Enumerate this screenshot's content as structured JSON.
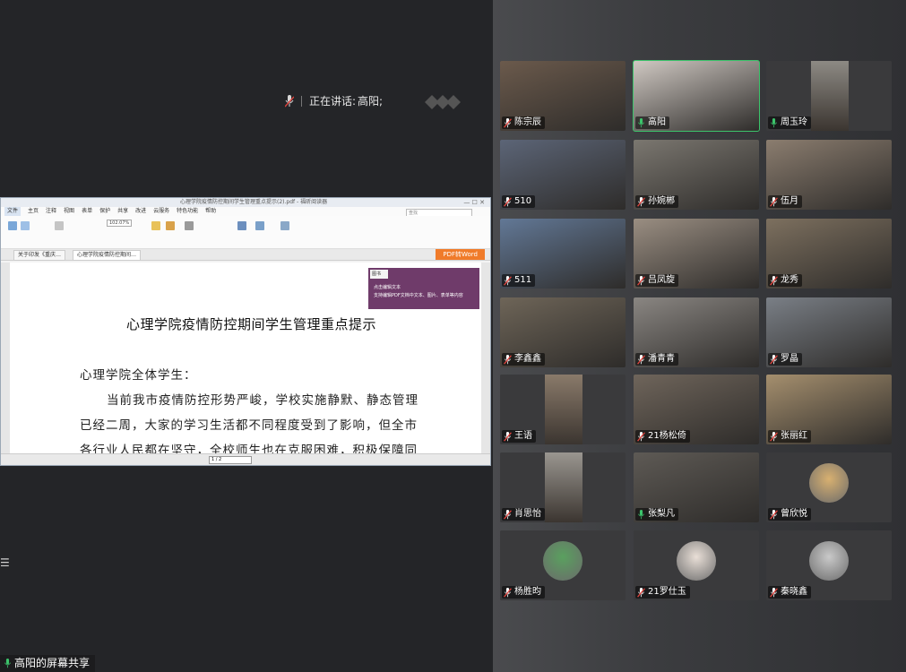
{
  "speaking": {
    "prefix": "正在讲话:",
    "name": "高阳;"
  },
  "share_label": "高阳的屏幕共享",
  "document": {
    "window_title": "心理学院疫情防控期间学生管理重点提示(2).pdf - 福昕阅读器",
    "search_placeholder": "查找",
    "menu": [
      "文件",
      "主页",
      "注释",
      "视图",
      "表单",
      "保护",
      "共享",
      "改进",
      "云服务",
      "特色功能",
      "帮助"
    ],
    "zoom": "102.07%",
    "tabs": [
      "关于印发《重庆…",
      "心理学院疫情防控期间…"
    ],
    "pdf_to_word": "PDF转Word",
    "popup_title": "图书",
    "popup_lines": [
      "点击编辑文本",
      "支持编辑PDF文档中文本、图片、表单等内容"
    ],
    "heading": "心理学院疫情防控期间学生管理重点提示",
    "paragraphs": [
      "心理学院全体学生：",
      "当前我市疫情防控形势严峻，学校实施静默、静态管理",
      "已经二周，大家的学习生活都不同程度受到了影响，但全市",
      "各行业人民都在坚守，全校师生也在克服困难，积极保障同"
    ],
    "page_indicator": "1 / 2"
  },
  "participants": [
    {
      "name": "陈宗辰",
      "muted": true,
      "active": false,
      "kind": "video",
      "scene": "#6b5a4c"
    },
    {
      "name": "高阳",
      "muted": false,
      "active": true,
      "kind": "video",
      "scene": "#cfc8c2"
    },
    {
      "name": "周玉玲",
      "muted": false,
      "active": false,
      "kind": "video-narrow",
      "scene": "#8d8a84"
    },
    {
      "name": "510",
      "muted": true,
      "active": false,
      "kind": "video",
      "scene": "#5c6577"
    },
    {
      "name": "孙婉郴",
      "muted": true,
      "active": false,
      "kind": "video",
      "scene": "#7b7770"
    },
    {
      "name": "伍月",
      "muted": true,
      "active": false,
      "kind": "video",
      "scene": "#8b7d6f"
    },
    {
      "name": "511",
      "muted": true,
      "active": false,
      "kind": "video",
      "scene": "#627896"
    },
    {
      "name": "吕凤旋",
      "muted": true,
      "active": false,
      "kind": "video",
      "scene": "#9a8e82"
    },
    {
      "name": "龙秀",
      "muted": true,
      "active": false,
      "kind": "video",
      "scene": "#7d705f"
    },
    {
      "name": "李鑫鑫",
      "muted": true,
      "active": false,
      "kind": "video",
      "scene": "#6e6558"
    },
    {
      "name": "潘青青",
      "muted": true,
      "active": false,
      "kind": "video",
      "scene": "#8a8682"
    },
    {
      "name": "罗晶",
      "muted": true,
      "active": false,
      "kind": "video",
      "scene": "#7a7f86"
    },
    {
      "name": "王语",
      "muted": true,
      "active": false,
      "kind": "video-narrow",
      "scene": "#8a7a6a"
    },
    {
      "name": "21杨松倚",
      "muted": true,
      "active": false,
      "kind": "video",
      "scene": "#6f655b"
    },
    {
      "name": "张丽红",
      "muted": true,
      "active": false,
      "kind": "video",
      "scene": "#a58f6e"
    },
    {
      "name": "肖思怡",
      "muted": true,
      "active": false,
      "kind": "video-narrow",
      "scene": "#9a9690"
    },
    {
      "name": "张梨凡",
      "muted": false,
      "active": false,
      "kind": "video",
      "scene": "#5e5a55"
    },
    {
      "name": "曾欣悦",
      "muted": true,
      "active": false,
      "kind": "avatar",
      "scene": "#d8b070"
    },
    {
      "name": "杨胜昀",
      "muted": true,
      "active": false,
      "kind": "avatar",
      "scene": "#5aa05f"
    },
    {
      "name": "21罗仕玉",
      "muted": true,
      "active": false,
      "kind": "avatar",
      "scene": "#e9dfd7"
    },
    {
      "name": "秦晓鑫",
      "muted": true,
      "active": false,
      "kind": "avatar",
      "scene": "#c9c9c9"
    }
  ],
  "colors": {
    "accent_active": "#3cc46b",
    "muted_mic": "#e0443e",
    "pdf_button": "#f07b2a"
  }
}
